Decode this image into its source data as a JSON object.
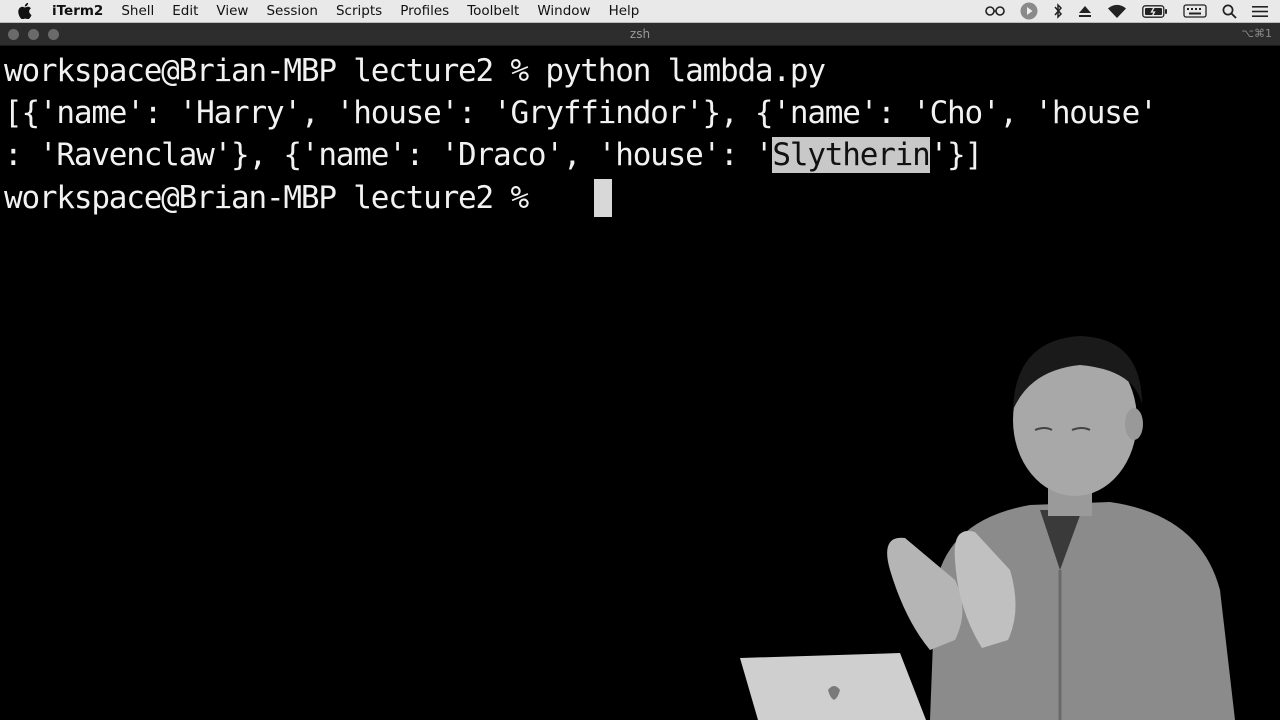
{
  "menubar": {
    "app_name": "iTerm2",
    "items": [
      "Shell",
      "Edit",
      "View",
      "Session",
      "Scripts",
      "Profiles",
      "Toolbelt",
      "Window",
      "Help"
    ],
    "status_icons": [
      "glasses-icon",
      "play-icon",
      "bluetooth-icon",
      "eject-icon",
      "wifi-icon",
      "battery-icon",
      "keyboard-icon",
      "search-icon",
      "list-icon"
    ]
  },
  "window": {
    "title": "zsh",
    "shortcut": "⌥⌘1"
  },
  "terminal": {
    "line1": "workspace@Brian-MBP lecture2 % python lambda.py",
    "line2": "[{'name': 'Harry', 'house': 'Gryffindor'}, {'name': 'Cho', 'house'",
    "line3_before": ": 'Ravenclaw'}, {'name': 'Draco', 'house': '",
    "line3_selected": "Slytherin",
    "line3_after": "'}]",
    "line4": "workspace@Brian-MBP lecture2 % "
  },
  "colors": {
    "terminal_bg": "#000000",
    "terminal_fg": "#f2f2f2",
    "selection_bg": "#c8c8c8",
    "menubar_bg": "#e9e9e9",
    "titlebar_bg": "#2d2d2d"
  }
}
